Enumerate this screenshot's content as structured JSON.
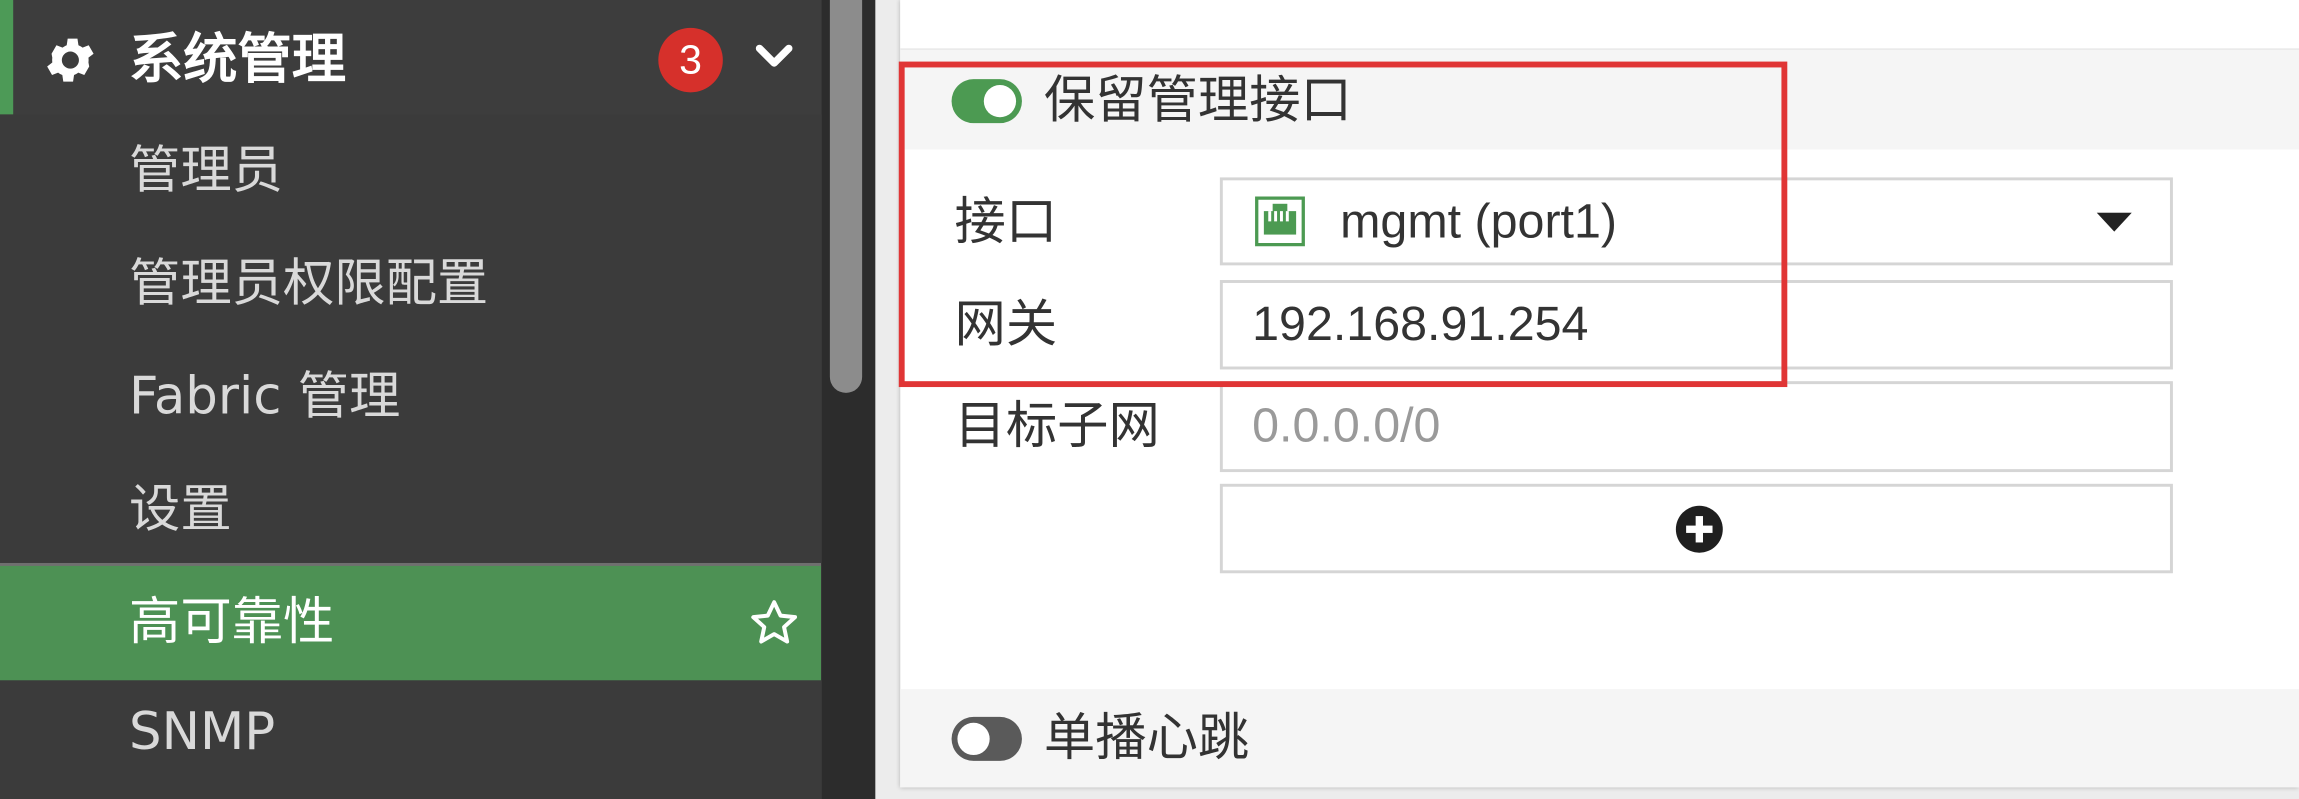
{
  "sidebar": {
    "group": {
      "title": "系统管理",
      "icon": "gear-icon",
      "badge": "3",
      "expanded": true
    },
    "items": [
      {
        "label": "管理员"
      },
      {
        "label": "管理员权限配置"
      },
      {
        "label": "Fabric 管理"
      },
      {
        "label": "设置"
      },
      {
        "label": "高可靠性",
        "active": true,
        "favorite_icon": "star-icon"
      },
      {
        "label": "SNMP"
      }
    ]
  },
  "form": {
    "reserve_mgmt": {
      "label": "保留管理接口",
      "enabled": true
    },
    "interface": {
      "label": "接口",
      "value": "mgmt (port1)",
      "icon": "ethernet-port-icon"
    },
    "gateway": {
      "label": "网关",
      "value": "192.168.91.254"
    },
    "dest_subnet": {
      "label": "目标子网",
      "placeholder": "0.0.0.0/0"
    },
    "add_icon": "plus-circle-icon",
    "unicast_heartbeat": {
      "label": "单播心跳",
      "enabled": false
    }
  },
  "colors": {
    "sidebar_bg": "#3b3b3b",
    "accent_green": "#4d9154",
    "badge_red": "#d6302b",
    "highlight_red": "#e03535"
  }
}
